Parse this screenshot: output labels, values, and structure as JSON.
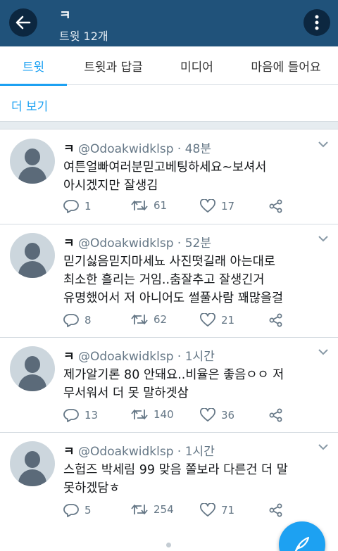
{
  "header": {
    "title": "ㅋ",
    "subtitle": "트윗 12개"
  },
  "tabs": [
    {
      "label": "트윗",
      "active": true
    },
    {
      "label": "트윗과 답글",
      "active": false
    },
    {
      "label": "미디어",
      "active": false
    },
    {
      "label": "마음에 들어요",
      "active": false
    }
  ],
  "see_more": "더 보기",
  "tweets": [
    {
      "name": "ㅋ",
      "handle": "@Odoakwidklsp",
      "time": "48분",
      "lines": [
        "여튼얼빠여러분믿고베팅하세요~보셔서",
        "아시겠지만 잘생김"
      ],
      "replies": "1",
      "retweets": "61",
      "likes": "17"
    },
    {
      "name": "ㅋ",
      "handle": "@Odoakwidklsp",
      "time": "52분",
      "lines": [
        "믿기싫음믿지마세뇨 사진떳길래 아는대로",
        "최소한 흘리는 거임..춤잘추고 잘생긴거",
        "유명했어서 저 아니어도 썰풀사람 꽤많을걸"
      ],
      "replies": "8",
      "retweets": "62",
      "likes": "21"
    },
    {
      "name": "ㅋ",
      "handle": "@Odoakwidklsp",
      "time": "1시간",
      "lines": [
        "제가알기론 80 안돼요..비율은 좋음ㅇㅇ 저",
        "무서워서 더 못 말하겟삼"
      ],
      "replies": "13",
      "retweets": "140",
      "likes": "36"
    },
    {
      "name": "ㅋ",
      "handle": "@Odoakwidklsp",
      "time": "1시간",
      "lines": [
        "스헙즈 박세림 99 맞음 쫄보라 다른건 더 말",
        "못하겠담ㅎ"
      ],
      "replies": "5",
      "retweets": "254",
      "likes": "71"
    }
  ],
  "colors": {
    "header_bg": "#20527a",
    "accent": "#1da1f2",
    "muted": "#657786"
  },
  "icons": {
    "back": "arrow-left-icon",
    "more": "vertical-dots-icon",
    "reply": "reply-icon",
    "retweet": "retweet-icon",
    "like": "heart-icon",
    "share": "share-icon",
    "compose": "compose-feather-icon"
  }
}
